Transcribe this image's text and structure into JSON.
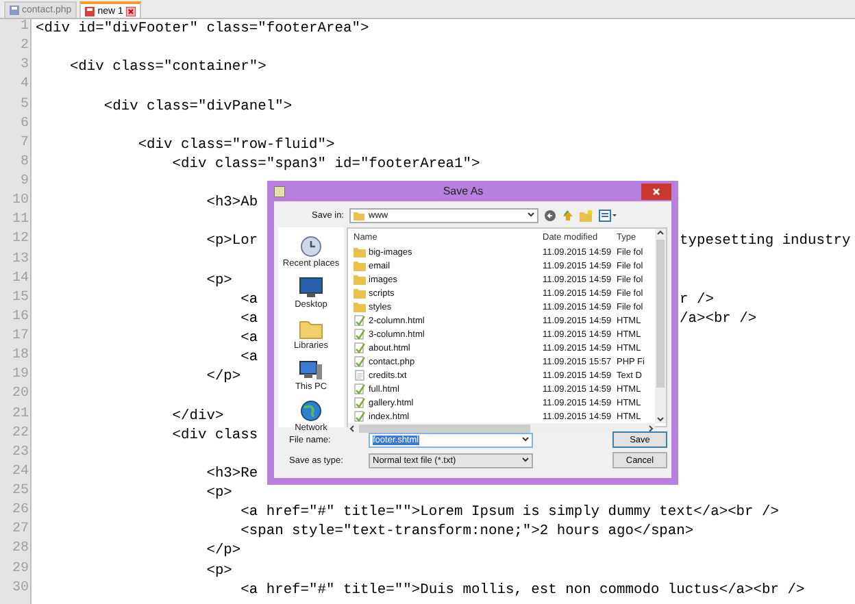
{
  "tabs": [
    {
      "label": "contact.php",
      "selected": false,
      "closable": false
    },
    {
      "label": "new 1",
      "selected": true,
      "closable": true
    }
  ],
  "editor": {
    "lines": [
      {
        "num": "1",
        "text": "<div id=\"divFooter\" class=\"footerArea\">"
      },
      {
        "num": "2"
      },
      {
        "num": "3",
        "text": "    <div class=\"container\">"
      },
      {
        "num": "4"
      },
      {
        "num": "5",
        "text": "        <div class=\"divPanel\">"
      },
      {
        "num": "6"
      },
      {
        "num": "7",
        "text": "            <div class=\"row-fluid\">"
      },
      {
        "num": "8",
        "text": "                <div class=\"span3\" id=\"footerArea1\">"
      },
      {
        "num": "9"
      },
      {
        "num": "10",
        "text": "                    <h3>Ab"
      },
      {
        "num": "11"
      },
      {
        "num": "12",
        "text": "                    <p>Lor",
        "right": "typesetting industry"
      },
      {
        "num": "13"
      },
      {
        "num": "14",
        "text": "                    <p>"
      },
      {
        "num": "15",
        "text": "                        <a",
        "right": "r />"
      },
      {
        "num": "16",
        "text": "                        <a",
        "right": "/a><br />"
      },
      {
        "num": "17",
        "text": "                        <a"
      },
      {
        "num": "18",
        "text": "                        <a"
      },
      {
        "num": "19",
        "text": "                    </p>"
      },
      {
        "num": "20"
      },
      {
        "num": "21",
        "text": "                </div>"
      },
      {
        "num": "22",
        "text": "                <div class"
      },
      {
        "num": "23"
      },
      {
        "num": "24",
        "text": "                    <h3>Re"
      },
      {
        "num": "25",
        "text": "                    <p>"
      },
      {
        "num": "26",
        "text": "                        <a href=\"#\" title=\"\">Lorem Ipsum is simply dummy text</a><br />"
      },
      {
        "num": "27",
        "text": "                        <span style=\"text-transform:none;\">2 hours ago</span>"
      },
      {
        "num": "28",
        "text": "                    </p>"
      },
      {
        "num": "29",
        "text": "                    <p>"
      },
      {
        "num": "30",
        "text": "                        <a href=\"#\" title=\"\">Duis mollis, est non commodo luctus</a><br />"
      }
    ]
  },
  "dialog": {
    "title": "Save As",
    "save_in_label": "Save in:",
    "save_in_value": "www",
    "places": [
      {
        "label": "Recent places",
        "kind": "recent"
      },
      {
        "label": "Desktop",
        "kind": "desktop"
      },
      {
        "label": "Libraries",
        "kind": "libraries"
      },
      {
        "label": "This PC",
        "kind": "pc"
      },
      {
        "label": "Network",
        "kind": "network"
      }
    ],
    "columns": [
      "Name",
      "Date modified",
      "Type"
    ],
    "files": [
      {
        "name": "big-images",
        "date": "11.09.2015 14:59",
        "type": "File fol",
        "kind": "folder"
      },
      {
        "name": "email",
        "date": "11.09.2015 14:59",
        "type": "File fol",
        "kind": "folder"
      },
      {
        "name": "images",
        "date": "11.09.2015 14:59",
        "type": "File fol",
        "kind": "folder"
      },
      {
        "name": "scripts",
        "date": "11.09.2015 14:59",
        "type": "File fol",
        "kind": "folder"
      },
      {
        "name": "styles",
        "date": "11.09.2015 14:59",
        "type": "File fol",
        "kind": "folder"
      },
      {
        "name": "2-column.html",
        "date": "11.09.2015 14:59",
        "type": "HTML",
        "kind": "html"
      },
      {
        "name": "3-column.html",
        "date": "11.09.2015 14:59",
        "type": "HTML",
        "kind": "html"
      },
      {
        "name": "about.html",
        "date": "11.09.2015 14:59",
        "type": "HTML",
        "kind": "html"
      },
      {
        "name": "contact.php",
        "date": "11.09.2015 15:57",
        "type": "PHP Fi",
        "kind": "html"
      },
      {
        "name": "credits.txt",
        "date": "11.09.2015 14:59",
        "type": "Text D",
        "kind": "text"
      },
      {
        "name": "full.html",
        "date": "11.09.2015 14:59",
        "type": "HTML",
        "kind": "html"
      },
      {
        "name": "gallery.html",
        "date": "11.09.2015 14:59",
        "type": "HTML",
        "kind": "html"
      },
      {
        "name": "index.html",
        "date": "11.09.2015 14:59",
        "type": "HTML",
        "kind": "html"
      }
    ],
    "file_name": {
      "label": "File name:",
      "value": "footer.shtml",
      "value_selected": true
    },
    "save_type": {
      "label": "Save as type:",
      "value": "Normal text file (*.txt)"
    },
    "buttons": [
      "Save",
      "Cancel"
    ]
  }
}
